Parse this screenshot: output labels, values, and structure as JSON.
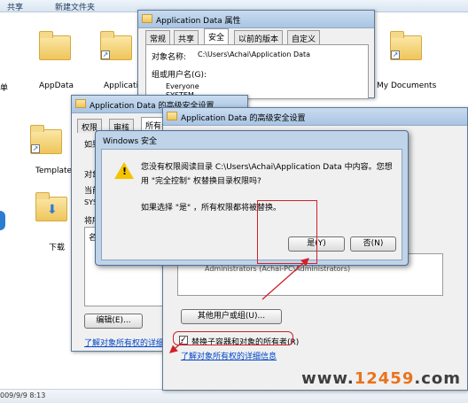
{
  "explorer": {
    "toolbar_share": "共享",
    "toolbar_new_folder": "新建文件夹",
    "folders": [
      {
        "label": "AppData"
      },
      {
        "label": "Applicatio"
      },
      {
        "label": "My Documents"
      },
      {
        "label": "Templates"
      },
      {
        "label": "下载"
      }
    ],
    "left_fragment": "单",
    "status_date": "009/9/9 8:13"
  },
  "props_window": {
    "title": "Application Data 属性",
    "tabs": [
      "常规",
      "共享",
      "安全",
      "以前的版本",
      "自定义"
    ],
    "object_label": "对象名称:",
    "object_value": "C:\\Users\\Achai\\Application Data",
    "group_label": "组或用户名(G):",
    "users": [
      "Everyone",
      "SYSTEM"
    ]
  },
  "adv_window_back": {
    "title": "Application Data 的高级安全设置",
    "tabs": [
      "权限",
      "审核",
      "所有者"
    ],
    "row_fragments": [
      "如果",
      "对象",
      "当前",
      "将所",
      "名",
      "SYS"
    ],
    "edit_button": "编辑(E)...",
    "link": "了解对象所有权的详细信息"
  },
  "adv_window_front": {
    "title": "Application Data 的高级安全设置",
    "other_user_button": "其他用户或组(U)...",
    "replace_checkbox_label": "替换子容器和对象的所有者(R)",
    "replace_checked": true,
    "link": "了解对象所有权的详细信息",
    "list_fragment": "Administrators (Achai-PC\\Administrators)"
  },
  "dialog": {
    "title": "Windows 安全",
    "message_line1": "您没有权限阅读目录 C:\\Users\\Achai\\Application Data 中内容。您想",
    "message_line2": "用 \"完全控制\" 权替换目录权限吗?",
    "message_line3": "如果选择 \"是\" ，所有权限都将被替换。",
    "yes_button": "是(Y)",
    "no_button": "否(N)"
  },
  "watermark": {
    "prefix": "www.",
    "brand": "12459",
    "suffix": ".com"
  },
  "colors": {
    "accent_red": "#d0202a",
    "title_blue": "#a9c4e2"
  }
}
